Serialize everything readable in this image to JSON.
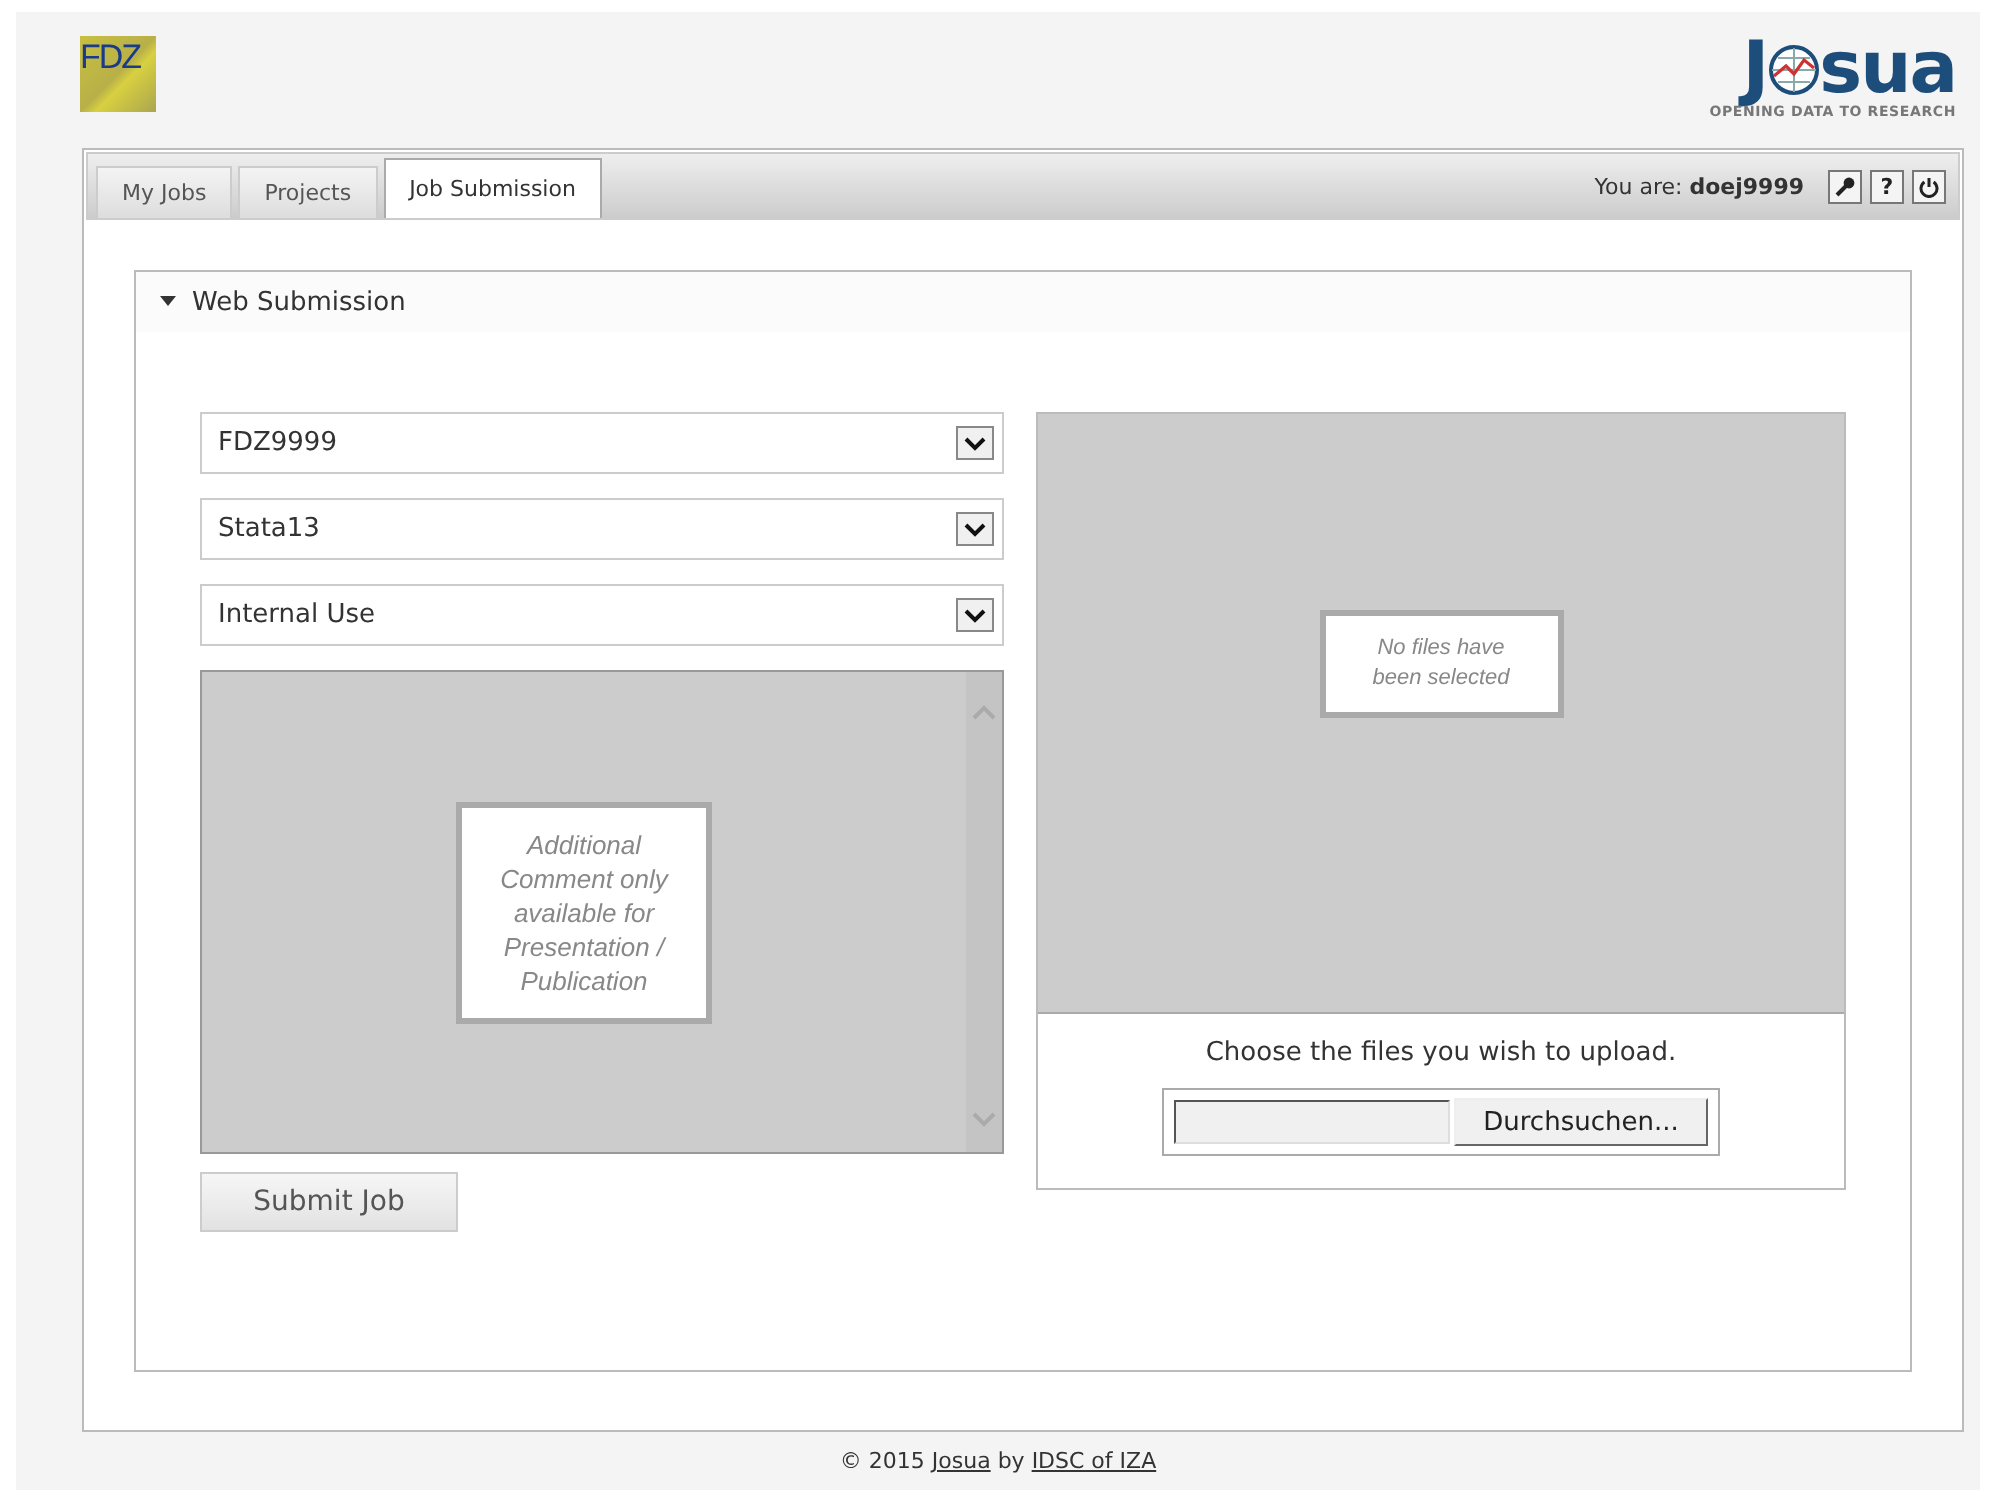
{
  "header": {
    "fdz_logo": "FDZ",
    "josua_logo": {
      "before": "J",
      "after": "sua",
      "tagline": "OPENING DATA TO RESEARCH"
    }
  },
  "tabs": [
    {
      "label": "My Jobs",
      "selected": false
    },
    {
      "label": "Projects",
      "selected": false
    },
    {
      "label": "Job Submission",
      "selected": true
    }
  ],
  "user": {
    "label": "You are:",
    "name": "doej9999",
    "help": "?"
  },
  "section": {
    "title": "Web Submission",
    "expanded": true
  },
  "selects": [
    {
      "value": "FDZ9999"
    },
    {
      "value": "Stata13"
    },
    {
      "value": "Internal Use"
    }
  ],
  "comment": {
    "placeholder": "Additional Comment only available for Presentation / Publication",
    "disabled": true
  },
  "submit": "Submit Job",
  "files": {
    "message": "No files have been selected",
    "prompt": "Choose the files you wish to upload.",
    "browse": "Durchsuchen..."
  },
  "footer": {
    "prefix": "© 2015",
    "link1": "Josua",
    "middle": "by",
    "link2": "IDSC of IZA"
  }
}
